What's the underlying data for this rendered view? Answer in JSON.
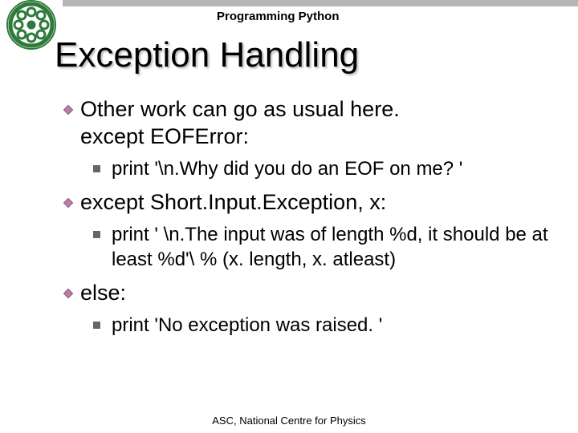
{
  "header": {
    "title": "Programming Python"
  },
  "slide": {
    "title": "Exception Handling"
  },
  "body": {
    "item1": {
      "line1": "Other work can go as usual here.",
      "line2": "except EOFError:",
      "sub1": "print '\\n.Why did you do an EOF on me? '"
    },
    "item2": {
      "line1": "except Short.Input.Exception, x:",
      "sub1": "print ' \\n.The input was of length %d, it should be at least %d'\\ % (x. length, x. atleast)"
    },
    "item3": {
      "line1": "else:",
      "sub1": "print 'No exception was raised. '"
    }
  },
  "footer": {
    "text": "ASC, National Centre for Physics"
  }
}
